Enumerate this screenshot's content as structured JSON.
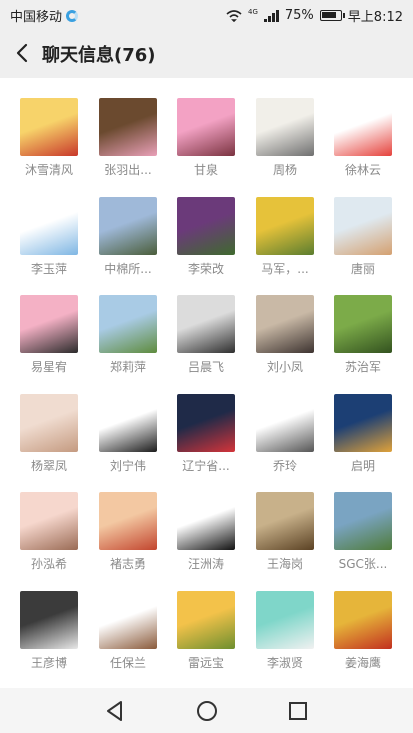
{
  "status": {
    "carrier": "中国移动",
    "network": "4G",
    "battery": "75%",
    "time": "早上8:12"
  },
  "header": {
    "title": "聊天信息(76)",
    "back_icon": "back-arrow-icon"
  },
  "members": [
    {
      "name": "沐雪清风",
      "colors": [
        "#f7d36a",
        "#c8382a"
      ]
    },
    {
      "name": "张羽出...",
      "colors": [
        "#6b4a2f",
        "#e9a0b8"
      ]
    },
    {
      "name": "甘泉",
      "colors": [
        "#f3a2c4",
        "#7a3340"
      ]
    },
    {
      "name": "周杨",
      "colors": [
        "#f1efe9",
        "#6f6f6f"
      ]
    },
    {
      "name": "徐林云",
      "colors": [
        "#ffffff",
        "#e5413b"
      ]
    },
    {
      "name": "李玉萍",
      "colors": [
        "#ffffff",
        "#7fb6e3"
      ]
    },
    {
      "name": "中棉所...",
      "colors": [
        "#9fb9d9",
        "#4a5d3a"
      ]
    },
    {
      "name": "李荣改",
      "colors": [
        "#6b3a7a",
        "#3f6a2e"
      ]
    },
    {
      "name": "马军，...",
      "colors": [
        "#e6c23a",
        "#5b7d2f"
      ]
    },
    {
      "name": "唐丽",
      "colors": [
        "#dfe9f0",
        "#d4a070"
      ]
    },
    {
      "name": "易星宥",
      "colors": [
        "#f4b1c5",
        "#2b2b2b"
      ]
    },
    {
      "name": "郑莉萍",
      "colors": [
        "#a9cbe5",
        "#5e8b3d"
      ]
    },
    {
      "name": "吕晨飞",
      "colors": [
        "#dcdcdc",
        "#2e2e2e"
      ]
    },
    {
      "name": "刘小凤",
      "colors": [
        "#c9b9a6",
        "#3d3330"
      ]
    },
    {
      "name": "苏治军",
      "colors": [
        "#7cab49",
        "#33521f"
      ]
    },
    {
      "name": "杨翠凤",
      "colors": [
        "#f0dcd0",
        "#c49a80"
      ]
    },
    {
      "name": "刘宁伟",
      "colors": [
        "#ffffff",
        "#1b1b1b"
      ]
    },
    {
      "name": "辽宁省...",
      "colors": [
        "#1f2a48",
        "#d4343a"
      ]
    },
    {
      "name": "乔玲",
      "colors": [
        "#ffffff",
        "#555555"
      ]
    },
    {
      "name": "启明",
      "colors": [
        "#1c3f74",
        "#e0a23a"
      ]
    },
    {
      "name": "孙泓希",
      "colors": [
        "#f6d7cd",
        "#9a6b55"
      ]
    },
    {
      "name": "褚志勇",
      "colors": [
        "#f3c8a2",
        "#c2452e"
      ]
    },
    {
      "name": "汪洲涛",
      "colors": [
        "#ffffff",
        "#111111"
      ]
    },
    {
      "name": "王海岗",
      "colors": [
        "#c8b18a",
        "#5b4224"
      ]
    },
    {
      "name": "SGC张...",
      "colors": [
        "#7aa4c2",
        "#4f7b3a"
      ]
    },
    {
      "name": "王彦博",
      "colors": [
        "#3b3b3b",
        "#e8e8e8"
      ]
    },
    {
      "name": "任保兰",
      "colors": [
        "#ffffff",
        "#8a5a3a"
      ]
    },
    {
      "name": "雷远宝",
      "colors": [
        "#f3c24a",
        "#6e8f2f"
      ]
    },
    {
      "name": "李淑贤",
      "colors": [
        "#7fd6c9",
        "#f1f1f1"
      ]
    },
    {
      "name": "姜海鹰",
      "colors": [
        "#e6b53a",
        "#c2301f"
      ]
    }
  ],
  "nav": {
    "back": "nav-back-triangle-icon",
    "home": "nav-home-circle-icon",
    "recents": "nav-recents-square-icon"
  }
}
